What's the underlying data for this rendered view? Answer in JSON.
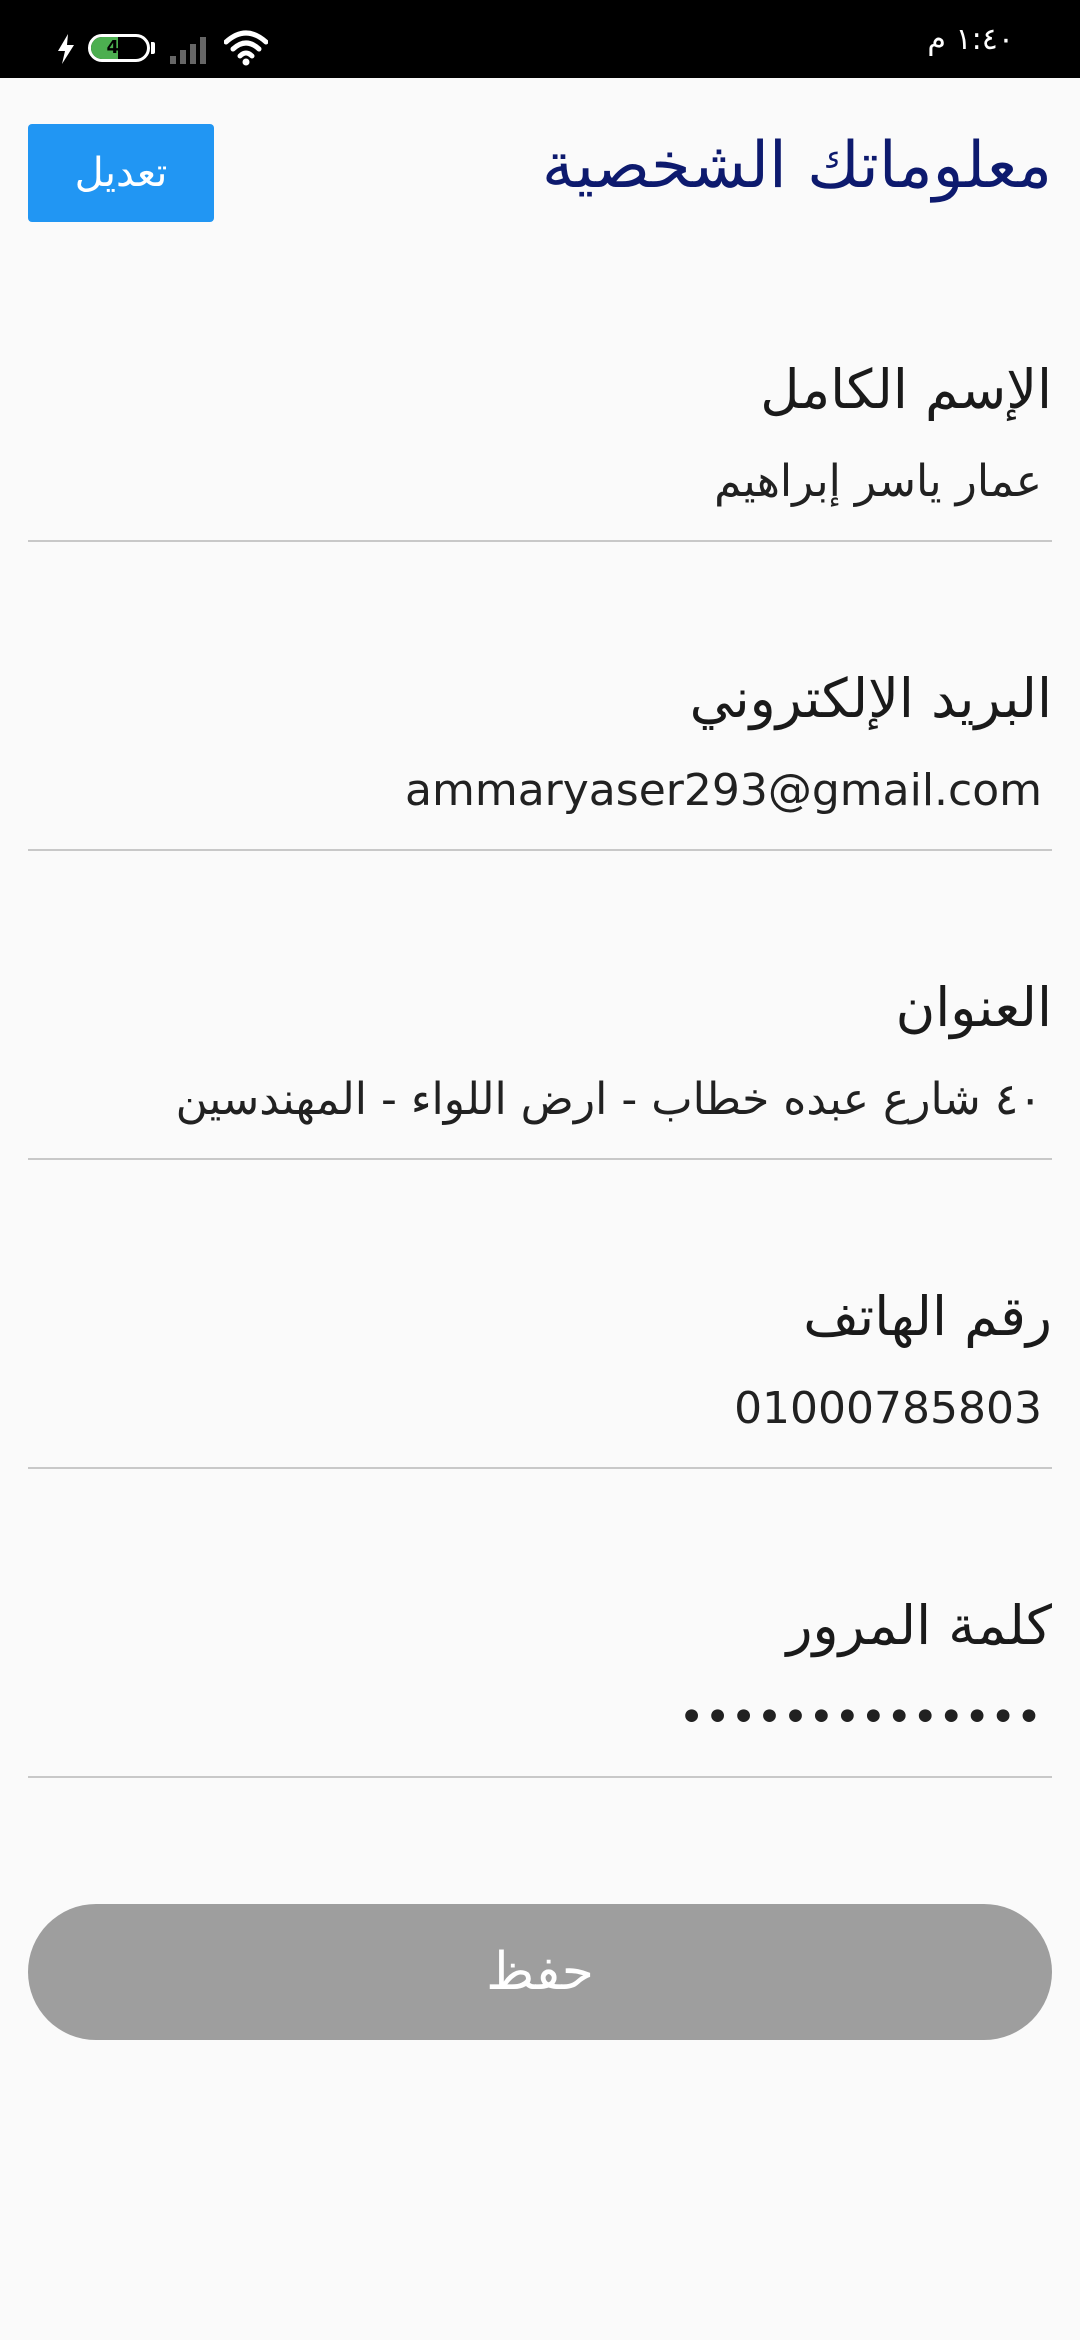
{
  "status_bar": {
    "time": "١:٤٠ م",
    "battery_level": "49",
    "battery_fraction": 0.49,
    "icons": [
      "charging-icon",
      "battery-icon",
      "signal-icon",
      "wifi-icon"
    ]
  },
  "header": {
    "title": "معلوماتك الشخصية",
    "edit_label": "تعديل"
  },
  "fields": [
    {
      "label": "الإسم الكامل",
      "value": "عمار ياسر إبراهيم"
    },
    {
      "label": "البريد الإلكتروني",
      "value": "ammaryaser293@gmail.com"
    },
    {
      "label": "العنوان",
      "value": "٤٠ شارع عبده خطاب - ارض اللواء - المهندسين"
    },
    {
      "label": "رقم الهاتف",
      "value": "01000785803"
    },
    {
      "label": "كلمة المرور",
      "value": "••••••••••••••"
    }
  ],
  "save_label": "حفظ",
  "colors": {
    "title": "#0d1a6e",
    "edit_button": "#2196f3",
    "save_button_disabled": "#9e9e9e",
    "divider": "#c8c8c8",
    "battery_fill": "#4caf50"
  }
}
